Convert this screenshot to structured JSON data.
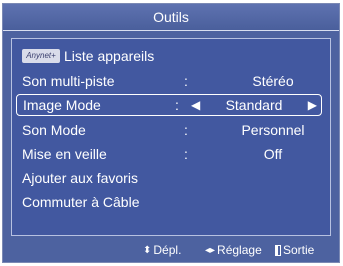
{
  "title": "Outils",
  "anynet_logo_text": "Anynet+",
  "menu": [
    {
      "label": "Liste appareils",
      "value": ""
    },
    {
      "label": "Son multi-piste",
      "value": "Stéréo"
    },
    {
      "label": "Image Mode",
      "value": "Standard"
    },
    {
      "label": "Son Mode",
      "value": "Personnel"
    },
    {
      "label": "Mise en veille",
      "value": "Off"
    },
    {
      "label": "Ajouter aux favoris",
      "value": ""
    },
    {
      "label": "Commuter à Câble",
      "value": ""
    }
  ],
  "colon": ":",
  "selected_arrows": {
    "left": "◀",
    "right": "▶"
  },
  "footer": {
    "move_icon": "⬍",
    "move_label": "Dépl.",
    "adjust_icon": "◂▸",
    "adjust_label": "Réglage",
    "exit_label": "Sortie"
  }
}
